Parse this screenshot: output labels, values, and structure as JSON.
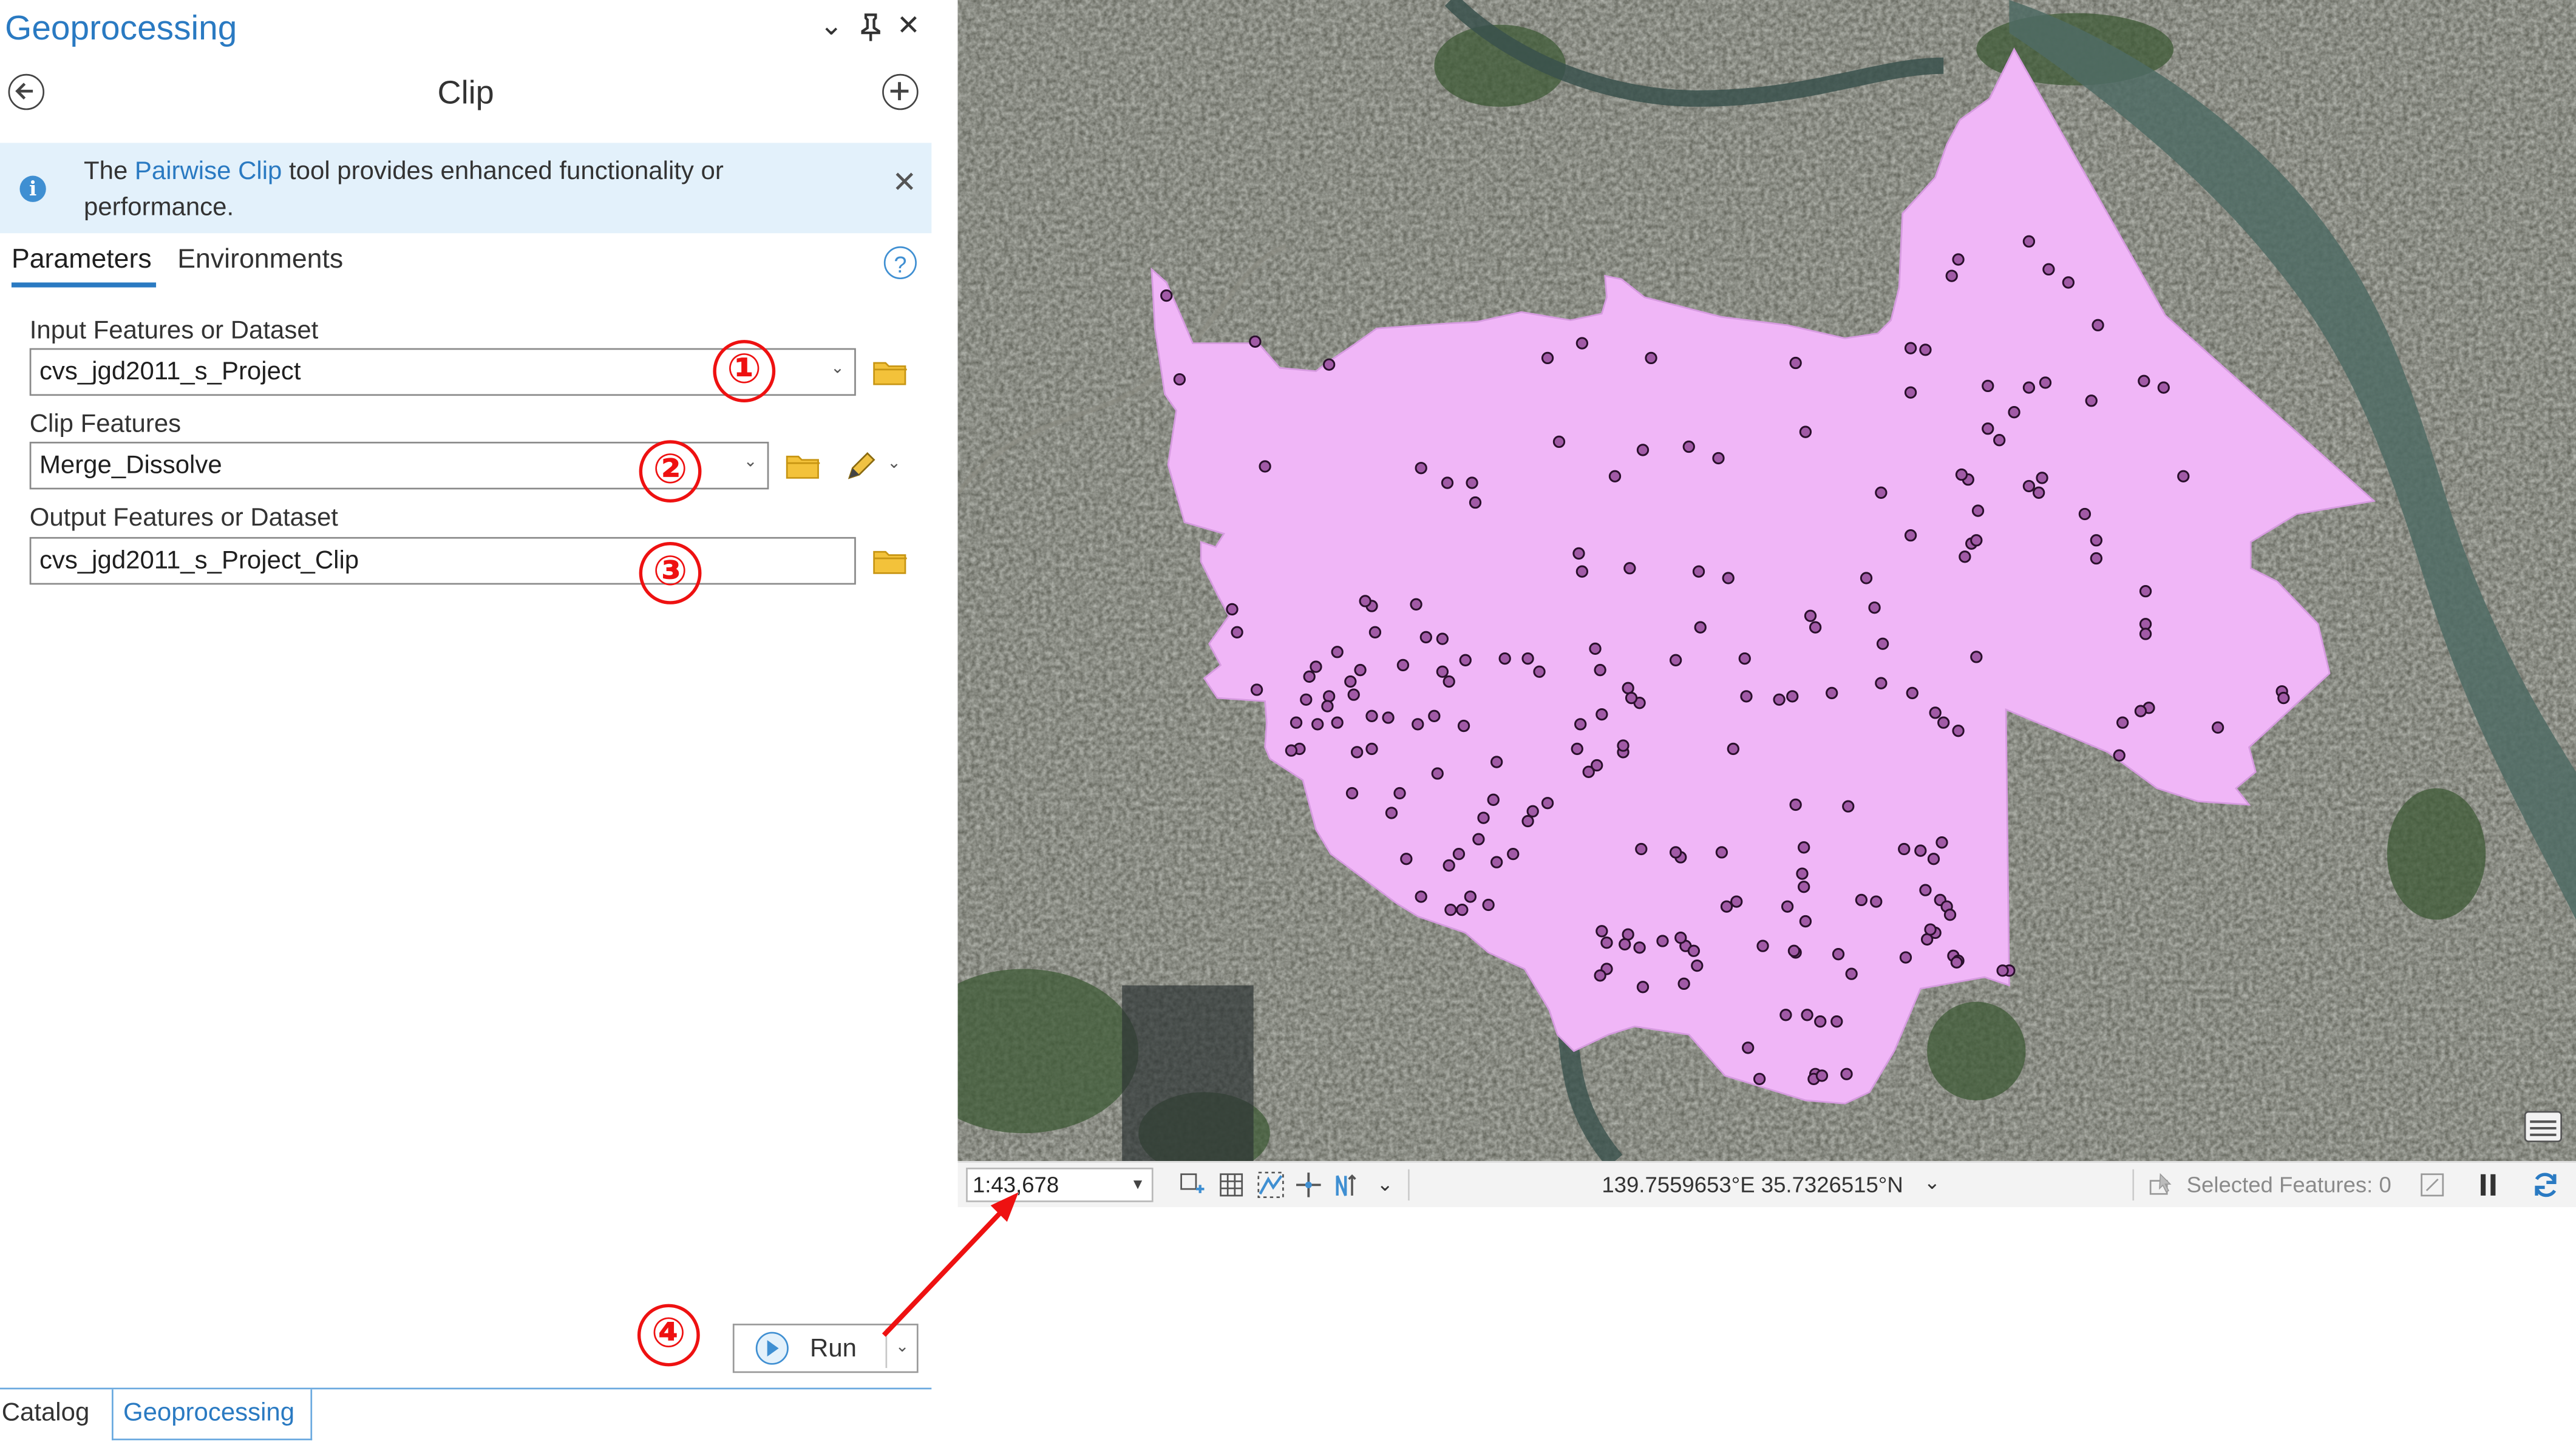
{
  "pane": {
    "title": "Geoprocessing",
    "controls": {
      "collapse_glyph": "⌄",
      "pin_glyph": "📌",
      "close_glyph": "✕"
    },
    "tool_title": "Clip",
    "banner": {
      "text_pre": "The ",
      "link": "Pairwise Clip",
      "text_post": " tool provides enhanced functionality or performance."
    },
    "tabs": [
      {
        "label": "Parameters",
        "active": true
      },
      {
        "label": "Environments",
        "active": false
      }
    ],
    "help_glyph": "?",
    "params": [
      {
        "label": "Input Features or Dataset",
        "value": "cvs_jgd2011_s_Project",
        "badge": "①"
      },
      {
        "label": "Clip Features",
        "value": "Merge_Dissolve",
        "badge": "②"
      },
      {
        "label": "Output Features or Dataset",
        "value": "cvs_jgd2011_s_Project_Clip",
        "badge": "③"
      }
    ],
    "run": {
      "label": "Run",
      "badge": "④"
    },
    "bottom_tabs": [
      {
        "label": "Catalog",
        "active": false
      },
      {
        "label": "Geoprocessing",
        "active": true
      }
    ]
  },
  "status": {
    "scale": "1:43,678",
    "coordinates": "139.7559653°E 35.7326515°N",
    "selected_features": "Selected Features: 0"
  },
  "colors": {
    "accent": "#2a7ac2",
    "banner_bg": "#e3f1fb",
    "badge_red": "#ee1111",
    "polygon_fill": "#f0b6f7",
    "point_fill": "#a15aa6",
    "point_stroke": "#2a0f2c"
  },
  "icons": [
    "back-icon",
    "add-icon",
    "info-icon",
    "close-icon",
    "help-icon",
    "folder-icon",
    "pencil-icon",
    "play-icon",
    "pause-icon",
    "refresh-icon"
  ]
}
